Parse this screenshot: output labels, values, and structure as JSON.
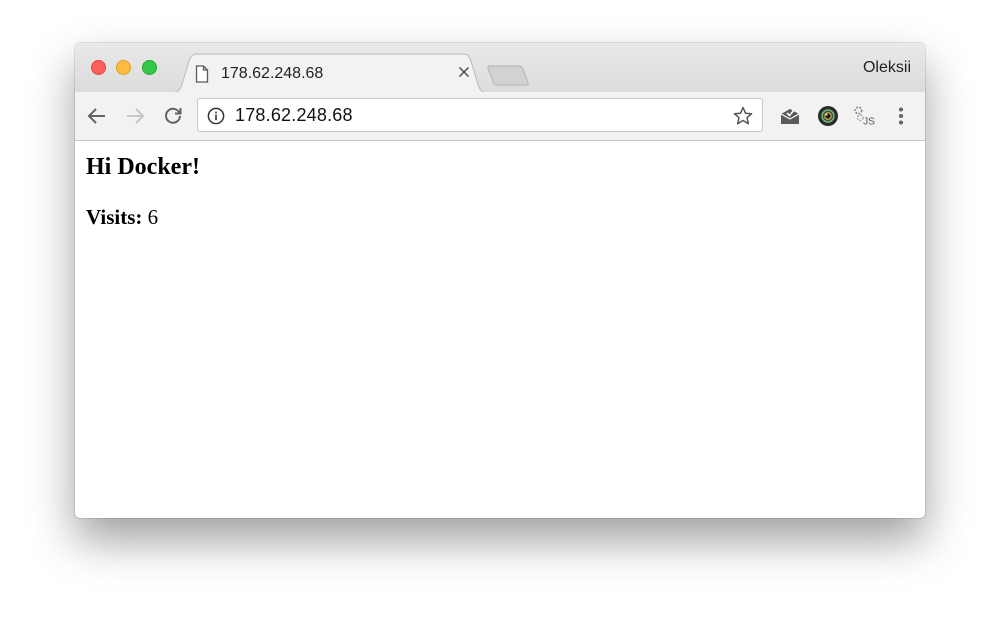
{
  "window": {
    "profile_name": "Oleksii"
  },
  "tab": {
    "title": "178.62.248.68",
    "icon": "document-icon"
  },
  "omnibox": {
    "url": "178.62.248.68",
    "left_icon": "info-icon",
    "right_icon": "star-icon"
  },
  "toolbar": {
    "back_icon": "back-arrow-icon",
    "forward_icon": "forward-arrow-icon",
    "reload_icon": "reload-icon",
    "extensions": [
      "mail-extension-icon",
      "camera-extension-icon",
      "js-extension-icon"
    ],
    "menu_icon": "more-vertical-icon"
  },
  "page": {
    "heading": "Hi Docker!",
    "visits_label": "Visits:",
    "visits_value": "6"
  },
  "colors": {
    "close": "#fc605c",
    "minimize": "#fdbc40",
    "maximize": "#34c84a"
  }
}
